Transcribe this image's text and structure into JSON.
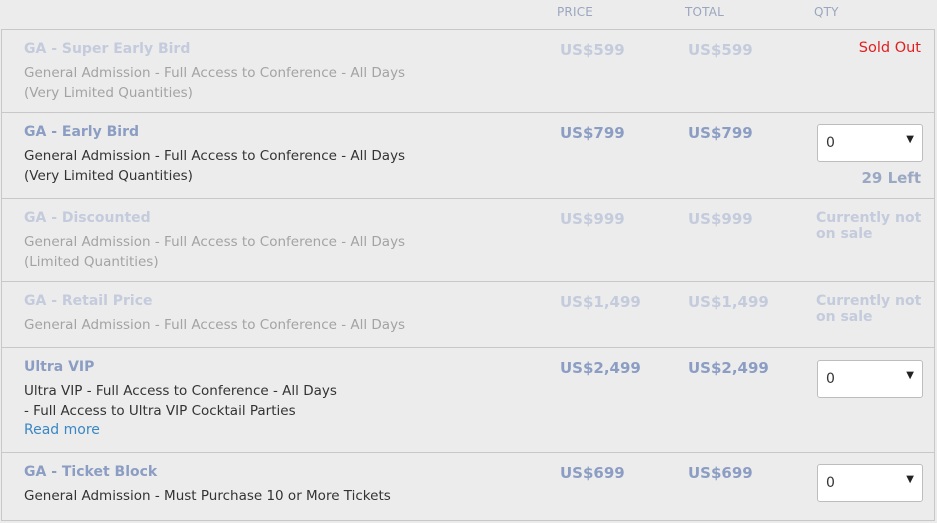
{
  "columns": {
    "price": "PRICE",
    "total": "TOTAL",
    "qty": "QTY"
  },
  "tickets": [
    {
      "name": "GA - Super Early Bird",
      "desc1": "General Admission - Full Access to Conference - All Days",
      "desc2": "(Very Limited Quantities)",
      "price": "US$599",
      "total": "US$599",
      "status": "Sold Out"
    },
    {
      "name": "GA - Early Bird",
      "desc1": "General Admission - Full Access to Conference - All Days",
      "desc2": "(Very Limited Quantities)",
      "price": "US$799",
      "total": "US$799",
      "qty": "0",
      "left": "29 Left"
    },
    {
      "name": "GA - Discounted",
      "desc1": "General Admission - Full Access to Conference - All Days",
      "desc2": "(Limited Quantities)",
      "price": "US$999",
      "total": "US$999",
      "status": "Currently not on sale"
    },
    {
      "name": "GA - Retail Price",
      "desc1": "General Admission - Full Access to Conference - All Days",
      "price": "US$1,499",
      "total": "US$1,499",
      "status": "Currently not on sale"
    },
    {
      "name": "Ultra VIP",
      "desc1": "Ultra VIP - Full Access to Conference - All Days",
      "desc2": "- Full Access to Ultra VIP Cocktail Parties",
      "read_more": "Read more",
      "price": "US$2,499",
      "total": "US$2,499",
      "qty": "0"
    },
    {
      "name": "GA - Ticket Block",
      "desc1": "General Admission - Must Purchase 10 or More Tickets",
      "price": "US$699",
      "total": "US$699",
      "qty": "0"
    }
  ],
  "colors": {
    "accent": "#8b9dc3",
    "sold_out": "#e02020",
    "link": "#3a87c3"
  },
  "icons": {
    "dropdown": "caret-down-icon"
  }
}
